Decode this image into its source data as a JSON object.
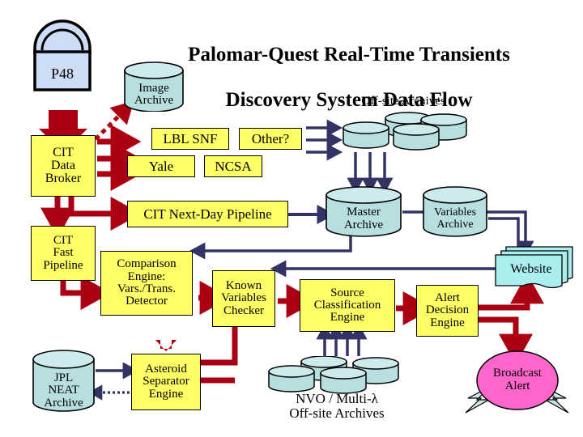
{
  "title": {
    "line1": "Palomar-Quest Real-Time Transients",
    "line2": "Discovery System Data Flow"
  },
  "labels": {
    "offsite_archives_top": "Off-site Archives",
    "nvo_archives": "NVO / Multi-λ\nOff-site Archives"
  },
  "nodes": {
    "p48": {
      "label": "P48",
      "shape": "telescope-dome",
      "color": "#ccddf5"
    },
    "image_archive": {
      "label": "Image\nArchive",
      "shape": "cylinder",
      "color": "#b8dfe0"
    },
    "cit_data_broker": {
      "label": "CIT\nData\nBroker",
      "shape": "box",
      "color": "#ffff66"
    },
    "lbl_snf": {
      "label": "LBL SNF",
      "shape": "box",
      "color": "#ffff66"
    },
    "other": {
      "label": "Other?",
      "shape": "box",
      "color": "#ffff66"
    },
    "yale": {
      "label": "Yale",
      "shape": "box",
      "color": "#ffff66"
    },
    "ncsa": {
      "label": "NCSA",
      "shape": "box",
      "color": "#ffff66"
    },
    "cit_next_day_pipeline": {
      "label": "CIT Next-Day Pipeline",
      "shape": "box",
      "color": "#ffff66"
    },
    "cit_fast_pipeline": {
      "label": "CIT\nFast\nPipeline",
      "shape": "box",
      "color": "#ffff66"
    },
    "comparison_engine": {
      "label": "Comparison\nEngine:\nVars./Trans.\nDetector",
      "shape": "box",
      "color": "#ffff66"
    },
    "known_variables_checker": {
      "label": "Known\nVariables\nChecker",
      "shape": "box",
      "color": "#ffff66"
    },
    "source_classification_engine": {
      "label": "Source\nClassification\nEngine",
      "shape": "box",
      "color": "#ffff66"
    },
    "alert_decision_engine": {
      "label": "Alert\nDecision\nEngine",
      "shape": "box",
      "color": "#ffff66"
    },
    "master_archive": {
      "label": "Master\nArchive",
      "shape": "cylinder",
      "color": "#b8dfe0"
    },
    "variables_archive": {
      "label": "Variables\nArchive",
      "shape": "cylinder",
      "color": "#b8dfe0"
    },
    "website": {
      "label": "Website",
      "shape": "stacked-document",
      "color": "#aaeeee"
    },
    "jpl_neat_archive": {
      "label": "JPL\nNEAT\nArchive",
      "shape": "cylinder",
      "color": "#b8dfe0"
    },
    "asteroid_separator_engine": {
      "label": "Asteroid\nSeparator\nEngine",
      "shape": "box",
      "color": "#ffff66"
    },
    "broadcast_alert": {
      "label": "Broadcast\nAlert",
      "shape": "ellipse-with-bolts",
      "color": "#ff66cc"
    }
  },
  "colors": {
    "dark_red_arrow": "#aa0011",
    "navy_arrow": "#333366",
    "yellow_fill": "#ffff66",
    "cylinder_fill": "#b8dfe0",
    "cylinder_top": "#cdebec",
    "dome_fill": "#ccddf5",
    "website_fill": "#aaeeee",
    "alert_fill": "#ff66cc",
    "bolt_fill": "#cfe6e6",
    "outline": "#000000"
  }
}
